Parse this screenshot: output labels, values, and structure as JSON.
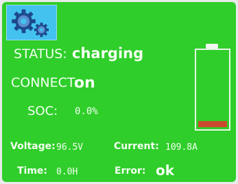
{
  "status": {
    "label": "STATUS:",
    "value": "charging"
  },
  "connect": {
    "label": "CONNECT:",
    "value": "on"
  },
  "soc": {
    "label": "SOC:",
    "value": "0.0%"
  },
  "voltage": {
    "label": "Voltage:",
    "value": "96.5V"
  },
  "current": {
    "label": "Current:",
    "value": "109.8A"
  },
  "time": {
    "label": "Time:",
    "value": "0.0H"
  },
  "error": {
    "label": "Error:",
    "value": "ok"
  },
  "battery": {
    "level_percent": 0.0
  },
  "colors": {
    "screen_bg": "#2fce2a",
    "text": "#f4fff2",
    "gear_bg": "#43c2f0",
    "battery_fill": "#c94a2c"
  },
  "icons": {
    "settings": "gears-icon",
    "battery": "battery-icon"
  }
}
